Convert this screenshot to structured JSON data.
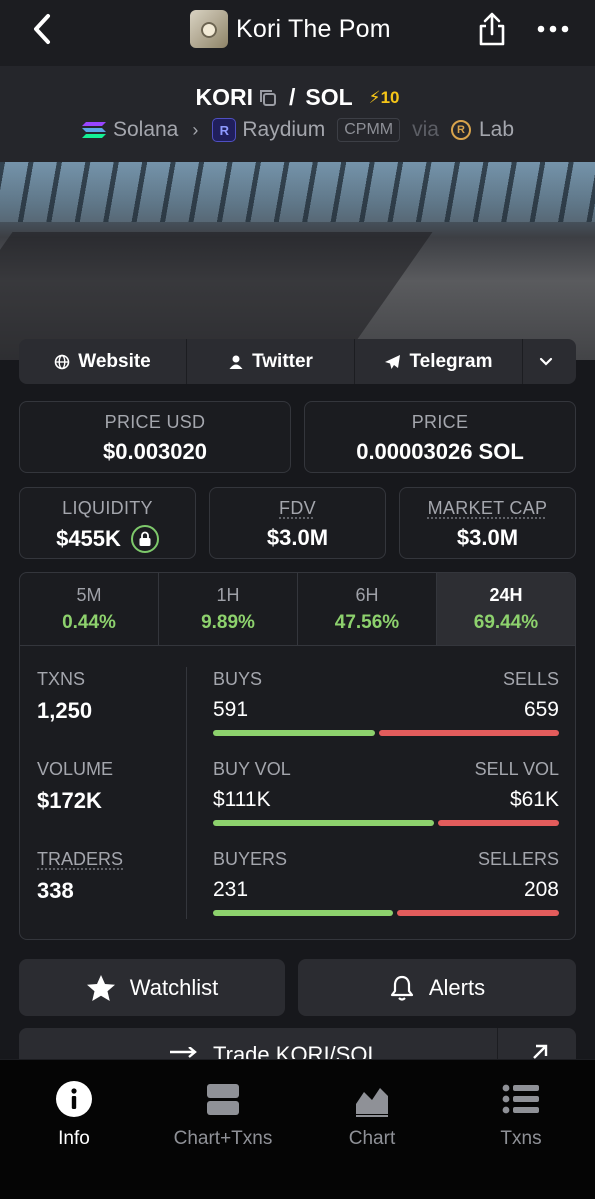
{
  "header": {
    "title": "Kori The Pom"
  },
  "pair": {
    "base": "KORI",
    "quote": "SOL",
    "separator": "/",
    "boost": "⚡10",
    "chain": "Solana",
    "dex": "Raydium",
    "pool_type": "CPMM",
    "via_label": "via",
    "launchpad": "Lab"
  },
  "links": {
    "website": "Website",
    "twitter": "Twitter",
    "telegram": "Telegram"
  },
  "prices": {
    "usd_label": "PRICE USD",
    "usd_value": "$0.003020",
    "native_label": "PRICE",
    "native_value": "0.00003026 SOL"
  },
  "metrics": {
    "liquidity_label": "LIQUIDITY",
    "liquidity_value": "$455K",
    "fdv_label": "FDV",
    "fdv_value": "$3.0M",
    "mcap_label": "MARKET CAP",
    "mcap_value": "$3.0M"
  },
  "timeframes": [
    {
      "label": "5M",
      "change": "0.44%"
    },
    {
      "label": "1H",
      "change": "9.89%"
    },
    {
      "label": "6H",
      "change": "47.56%"
    },
    {
      "label": "24H",
      "change": "69.44%"
    }
  ],
  "selected_timeframe": "24H",
  "txns": {
    "txns_label": "TXNS",
    "txns_value": "1,250",
    "volume_label": "VOLUME",
    "volume_value": "$172K",
    "traders_label": "TRADERS",
    "traders_value": "338",
    "buys_label": "BUYS",
    "buys_value": "591",
    "sells_label": "SELLS",
    "sells_value": "659",
    "buyvol_label": "BUY VOL",
    "buyvol_value": "$111K",
    "sellvol_label": "SELL VOL",
    "sellvol_value": "$61K",
    "buyers_label": "BUYERS",
    "buyers_value": "231",
    "sellers_label": "SELLERS",
    "sellers_value": "208"
  },
  "ratios": {
    "buys": 0.473,
    "buy_vol": 0.645,
    "buyers": 0.526
  },
  "colors": {
    "positive": "#8dd16d",
    "negative": "#e35c5c",
    "boost": "#f5c518"
  },
  "actions": {
    "watchlist": "Watchlist",
    "alerts": "Alerts",
    "trade": "Trade KORI/SOL"
  },
  "tabs": [
    {
      "label": "Info",
      "icon": "info-icon",
      "active": true
    },
    {
      "label": "Chart+Txns",
      "icon": "chart-txns-icon",
      "active": false
    },
    {
      "label": "Chart",
      "icon": "chart-icon",
      "active": false
    },
    {
      "label": "Txns",
      "icon": "list-icon",
      "active": false
    }
  ]
}
